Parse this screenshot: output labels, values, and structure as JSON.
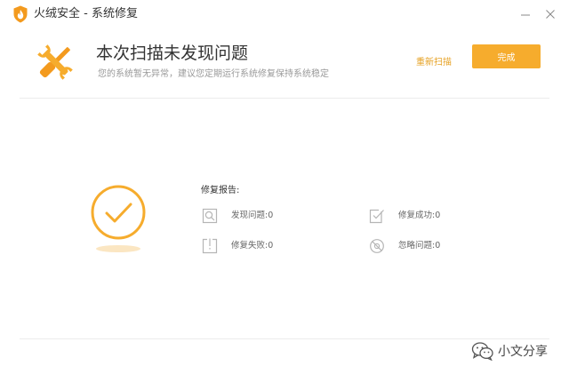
{
  "window": {
    "title": "火绒安全 - 系统修复"
  },
  "header": {
    "title": "本次扫描未发现问题",
    "subtitle": "您的系统暂无异常，建议您定期运行系统修复保持系统稳定",
    "rescan_label": "重新扫描",
    "done_label": "完成"
  },
  "report": {
    "title": "修复报告:",
    "stats": {
      "found": "发现问题:0",
      "success": "修复成功:0",
      "failed": "修复失败:0",
      "ignored": "忽略问题:0"
    }
  },
  "watermark": {
    "text": "小文分享"
  },
  "colors": {
    "accent": "#f6ac2d",
    "accent_text": "#e6a123",
    "icon_gray": "#b5b5b5",
    "divider": "#ececec"
  },
  "icons": {
    "app": "huorong-flame-icon",
    "minimize": "minimize-icon",
    "close": "close-icon",
    "header": "wrench-screwdriver-icon",
    "status": "checkmark-circle-icon",
    "found": "search-doc-icon",
    "success": "check-box-icon",
    "failed": "error-box-icon",
    "ignored": "ignore-circle-icon",
    "watermark": "wechat-icon"
  }
}
